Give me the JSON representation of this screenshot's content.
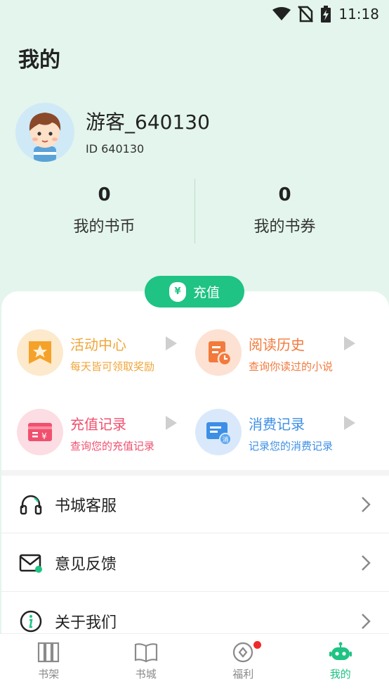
{
  "status_bar": {
    "time": "11:18"
  },
  "header": {
    "title": "我的"
  },
  "profile": {
    "username": "游客_640130",
    "user_id": "ID 640130"
  },
  "stats": [
    {
      "value": "0",
      "label": "我的书币"
    },
    {
      "value": "0",
      "label": "我的书券"
    }
  ],
  "recharge": {
    "label": "充值",
    "icon_char": "¥"
  },
  "features": [
    {
      "title": "活动中心",
      "subtitle": "每天皆可领取奖励",
      "color": "#f0a63a",
      "bg": "#fde9cc"
    },
    {
      "title": "阅读历史",
      "subtitle": "查询你读过的小说",
      "color": "#f27a3c",
      "bg": "#fde1d2"
    },
    {
      "title": "充值记录",
      "subtitle": "查询您的充值记录",
      "color": "#f0506e",
      "bg": "#fcdde3"
    },
    {
      "title": "消费记录",
      "subtitle": "记录您的消费记录",
      "color": "#3d8fe6",
      "bg": "#d9e9fb"
    }
  ],
  "recharge_icon_char": "¥",
  "consume_icon_char": "消",
  "menu": [
    {
      "label": "书城客服",
      "icon": "headset-icon"
    },
    {
      "label": "意见反馈",
      "icon": "mail-icon"
    },
    {
      "label": "关于我们",
      "icon": "info-icon"
    }
  ],
  "tabs": [
    {
      "label": "书架",
      "icon": "bookshelf-icon",
      "active": false
    },
    {
      "label": "书城",
      "icon": "book-icon",
      "active": false
    },
    {
      "label": "福利",
      "icon": "welfare-icon",
      "active": false
    },
    {
      "label": "我的",
      "icon": "robot-icon",
      "active": true
    }
  ],
  "colors": {
    "accent": "#1fc384",
    "header_bg": "#e3f5ec",
    "badge_red": "#ef2a2a"
  }
}
